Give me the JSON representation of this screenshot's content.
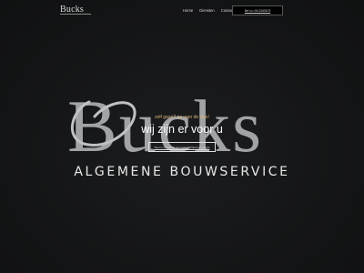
{
  "header": {
    "logo_text": "Bucks",
    "nav": [
      "Home",
      "Diensten",
      "Contact"
    ],
    "cta_label": "Bel nu: 0612345678"
  },
  "hero": {
    "logo_word": "Bucks",
    "tagline": "zelf gaan? ga voor de klus!",
    "headline": "wij zijn er voor u",
    "button_label": "Neem contact op voor een vrijblijvende offerte",
    "subtitle": "ALGEMENE BOUWSERVICE"
  },
  "colors": {
    "background": "#141516",
    "logo_gray": "#a9abae",
    "tagline": "#d9b27a",
    "text": "#ffffff"
  }
}
